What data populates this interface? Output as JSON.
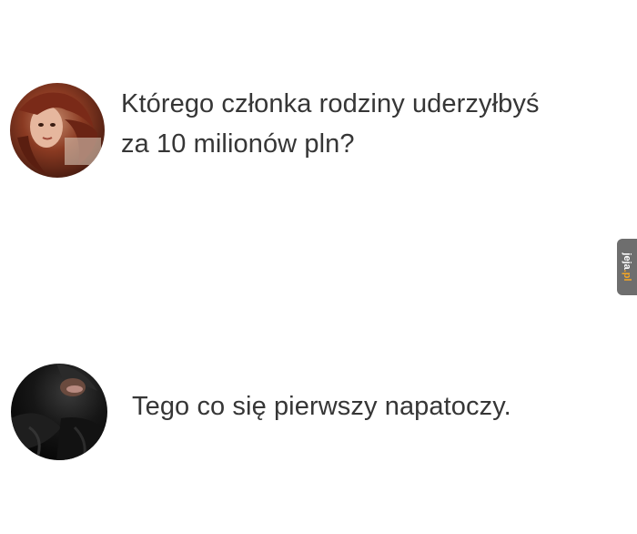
{
  "conversation": {
    "question": {
      "avatar_icon": "user-avatar-photo",
      "lines": [
        "Którego członka rodziny uderzyłbyś",
        "za 10 milionów pln?"
      ]
    },
    "answer": {
      "avatar_icon": "user-avatar-photo-dark",
      "lines": [
        "Tego co się pierwszy napatoczy."
      ]
    }
  },
  "watermark": {
    "text": "jeja.pl",
    "bg_color": "#6e6e6e",
    "accent_color": "#f5a623"
  },
  "colors": {
    "background": "#ffffff",
    "text": "#363636"
  }
}
